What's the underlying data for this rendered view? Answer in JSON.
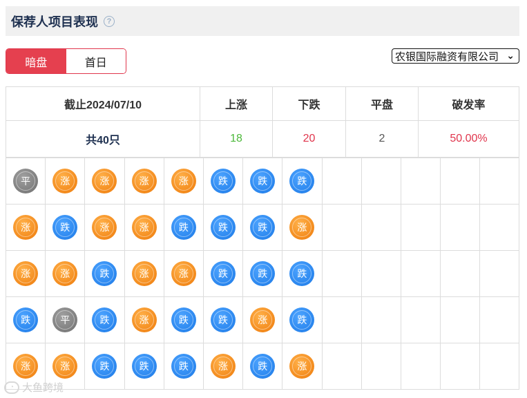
{
  "header": {
    "title": "保荐人项目表现",
    "help": "?"
  },
  "tabs": [
    {
      "label": "暗盘",
      "active": true
    },
    {
      "label": "首日",
      "active": false
    }
  ],
  "sponsor_select": {
    "value": "农银国际融资有限公司"
  },
  "summary": {
    "headers": {
      "date": "截止2024/07/10",
      "up": "上涨",
      "down": "下跌",
      "flat": "平盘",
      "break_rate": "破发率"
    },
    "values": {
      "total": "共40只",
      "up": "18",
      "down": "20",
      "flat": "2",
      "break_rate": "50.00%"
    }
  },
  "labels": {
    "up": "涨",
    "down": "跌",
    "flat": "平"
  },
  "grid_rows": [
    [
      "flat",
      "up",
      "up",
      "up",
      "up",
      "down",
      "down",
      "down"
    ],
    [
      "up",
      "down",
      "up",
      "up",
      "down",
      "down",
      "down",
      "up"
    ],
    [
      "up",
      "up",
      "down",
      "up",
      "up",
      "down",
      "down",
      "down"
    ],
    [
      "down",
      "flat",
      "down",
      "up",
      "down",
      "down",
      "up",
      "down"
    ],
    [
      "up",
      "up",
      "down",
      "down",
      "down",
      "up",
      "down",
      "up"
    ]
  ],
  "grid_columns": 13,
  "colors": {
    "up": "#f38a1c",
    "down": "#2a86ee",
    "flat": "#7d7d7d",
    "accent": "#e5404f"
  },
  "watermark": {
    "text": "大鱼跨境"
  }
}
